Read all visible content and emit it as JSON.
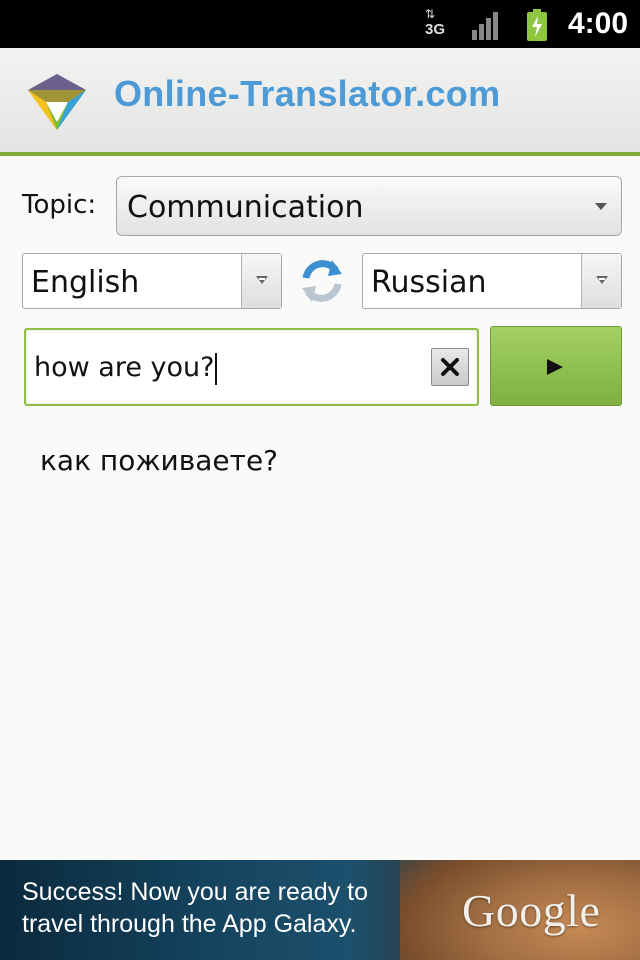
{
  "status_bar": {
    "network_arrows": "⇅",
    "network_type": "3G",
    "time": "4:00",
    "icons": [
      "data-activity-icon",
      "signal-icon",
      "battery-icon"
    ]
  },
  "header": {
    "title": "Online-Translator.com",
    "logo_icon": "online-translator-logo",
    "title_color": "#4c9ad6",
    "accent_color": "#7fab3a"
  },
  "topic": {
    "label": "Topic:",
    "selected": "Communication"
  },
  "languages": {
    "source": "English",
    "target": "Russian",
    "swap_icon": "swap-arrows-icon"
  },
  "input": {
    "value": "how are you?",
    "clear_icon": "clear-x-icon",
    "submit_icon": "play-icon"
  },
  "output": {
    "text": "как поживаете?"
  },
  "ad": {
    "text": "Success! Now you are ready to travel through the App Galaxy.",
    "brand": "Google"
  }
}
